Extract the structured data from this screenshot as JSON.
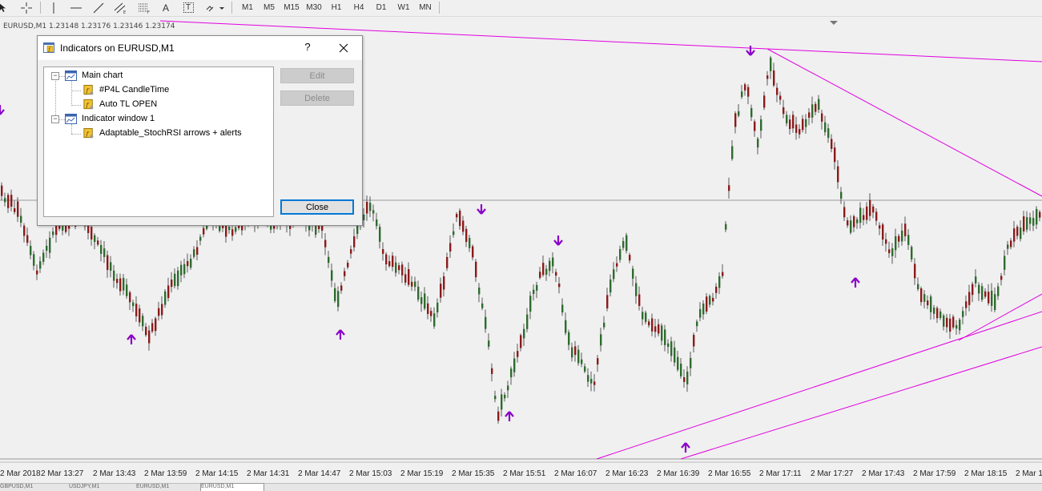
{
  "toolbar": {
    "tools": [
      {
        "icon": "cursor-arrow-icon"
      },
      {
        "icon": "crosshair-icon"
      },
      {
        "icon": "vertical-line-icon"
      },
      {
        "icon": "horizontal-line-icon"
      },
      {
        "icon": "trendline-icon"
      },
      {
        "icon": "equidistant-channel-icon"
      },
      {
        "icon": "fibonacci-icon"
      },
      {
        "icon": "text-icon",
        "label": "A"
      },
      {
        "icon": "text-label-icon",
        "label": "T"
      },
      {
        "icon": "shapes-dropdown-icon"
      }
    ],
    "timeframes": [
      "M1",
      "M5",
      "M15",
      "M30",
      "H1",
      "H4",
      "D1",
      "W1",
      "MN"
    ]
  },
  "chart": {
    "symbol_info": "EURUSD,M1  1.23148 1.23176 1.23146 1.23174",
    "time_labels": [
      "2 Mar 2018",
      "2 Mar 13:27",
      "2 Mar 13:43",
      "2 Mar 13:59",
      "2 Mar 14:15",
      "2 Mar 14:31",
      "2 Mar 14:47",
      "2 Mar 15:03",
      "2 Mar 15:19",
      "2 Mar 15:35",
      "2 Mar 15:51",
      "2 Mar 16:07",
      "2 Mar 16:23",
      "2 Mar 16:39",
      "2 Mar 16:55",
      "2 Mar 17:11",
      "2 Mar 17:27",
      "2 Mar 17:43",
      "2 Mar 17:59",
      "2 Mar 18:15",
      "2 Mar 18"
    ],
    "colors": {
      "bull": "#2e6b2e",
      "bear": "#8b1a1a",
      "trendline": "#e000e0",
      "arrow": "#8a00c8",
      "gridline": "#9a9a9a"
    }
  },
  "tabs": [
    {
      "label": "GBPUSD,M1"
    },
    {
      "label": "USDJPY,M1"
    },
    {
      "label": "EURUSD,M1"
    },
    {
      "label": "EURUSD,M1"
    }
  ],
  "dialog": {
    "title": "Indicators on EURUSD,M1",
    "help": "?",
    "tree": [
      {
        "label": "Main chart",
        "type": "window",
        "children": [
          {
            "label": "#P4L CandleTime"
          },
          {
            "label": "Auto TL OPEN"
          }
        ]
      },
      {
        "label": "Indicator window 1",
        "type": "window",
        "children": [
          {
            "label": "Adaptable_StochRSI arrows + alerts"
          }
        ]
      }
    ],
    "buttons": {
      "edit": "Edit",
      "delete": "Delete",
      "close": "Close"
    }
  }
}
